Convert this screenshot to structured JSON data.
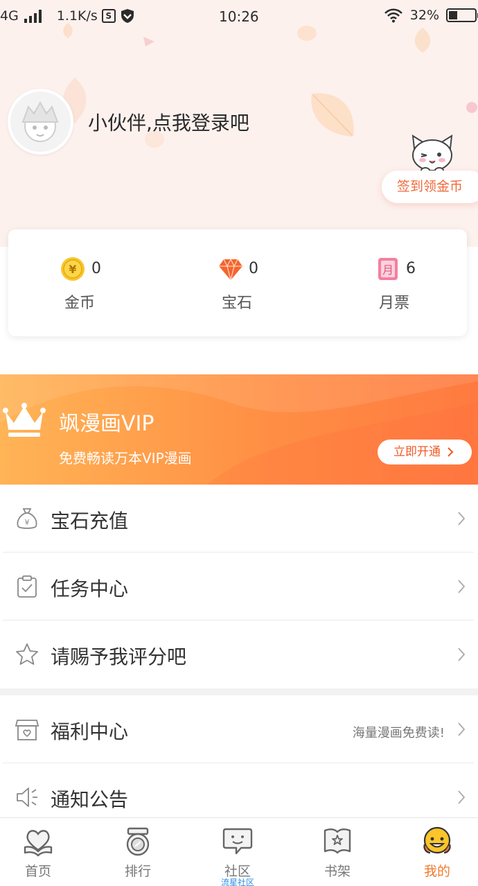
{
  "status_bar": {
    "network": "4G",
    "speed": "1.1K/s",
    "time": "10:26",
    "battery": "32%"
  },
  "profile": {
    "login_prompt": "小伙伴,点我登录吧",
    "checkin_label": "签到领金币"
  },
  "wallet": {
    "items": [
      {
        "icon": "coin-icon",
        "value": "0",
        "label": "金币"
      },
      {
        "icon": "gem-icon",
        "value": "0",
        "label": "宝石"
      },
      {
        "icon": "monthly-ticket-icon",
        "value": "6",
        "label": "月票"
      }
    ]
  },
  "vip": {
    "title": "飒漫画VIP",
    "subtitle": "免费畅读万本VIP漫画",
    "button_label": "立即开通"
  },
  "menu": {
    "items": [
      {
        "icon": "money-bag-icon",
        "label": "宝石充值",
        "hint": ""
      },
      {
        "icon": "clipboard-check-icon",
        "label": "任务中心",
        "hint": ""
      },
      {
        "icon": "star-icon",
        "label": "请赐予我评分吧",
        "hint": ""
      },
      {
        "icon": "gift-shop-icon",
        "label": "福利中心",
        "hint": "海量漫画免费读!"
      },
      {
        "icon": "speaker-icon",
        "label": "通知公告",
        "hint": ""
      }
    ]
  },
  "bottom_nav": {
    "items": [
      {
        "icon": "heart-book-icon",
        "label": "首页",
        "sub": ""
      },
      {
        "icon": "medal-icon",
        "label": "排行",
        "sub": ""
      },
      {
        "icon": "chat-bubble-icon",
        "label": "社区",
        "sub": "流星社区"
      },
      {
        "icon": "bookshelf-icon",
        "label": "书架",
        "sub": ""
      },
      {
        "icon": "smiley-icon",
        "label": "我的",
        "sub": ""
      }
    ],
    "active_index": 4
  },
  "colors": {
    "accent": "#f07b2f",
    "header_bg": "#fdf1ee",
    "vip_gradient_start": "#ffb456",
    "vip_gradient_end": "#ff7a40"
  }
}
